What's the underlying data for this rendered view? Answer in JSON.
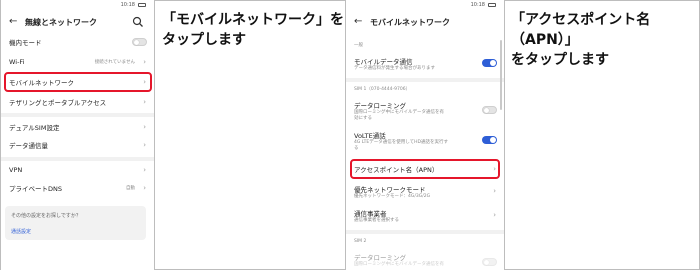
{
  "status": {
    "time1": "10:18",
    "time2": "10:18"
  },
  "left_screen": {
    "title": "無線とネットワーク",
    "items": [
      {
        "label": "機内モード"
      },
      {
        "label": "Wi-Fi",
        "value": "接続されていません"
      },
      {
        "label": "モバイルネットワーク"
      },
      {
        "label": "テザリングとポータブルアクセス"
      },
      {
        "label": "デュアルSIM設定"
      },
      {
        "label": "データ通信量"
      },
      {
        "label": "VPN"
      },
      {
        "label": "プライベートDNS",
        "value": "自動"
      }
    ],
    "help_card": {
      "question": "その他の設定をお探しですか？",
      "link": "通話設定"
    }
  },
  "instruction1": {
    "line1": "「モバイルネットワーク」を",
    "line2": "タップします"
  },
  "right_screen": {
    "title": "モバイルネットワーク",
    "section_general": "一般",
    "mobile_data": {
      "label": "モバイルデータ通信",
      "sub": "データ通信料が発生する場合があります"
    },
    "section_sim1": "SIM 1（070-4444-9706）",
    "roaming": {
      "label": "データローミング",
      "sub1": "国際ローミング中にモバイルデータ通信を有",
      "sub2": "効にする"
    },
    "volte": {
      "label": "VoLTE通話",
      "sub1": "4G LTEデータ通信を使用してHD通話を実行す",
      "sub2": "る"
    },
    "apn": {
      "label": "アクセスポイント名（APN）"
    },
    "pref_network": {
      "label": "優先ネットワークモード",
      "sub": "優先ネットワークモード：4G/3G/2G"
    },
    "carrier": {
      "label": "通信事業者",
      "sub": "通信事業者を選択する"
    },
    "section_sim2": "SIM 2",
    "roaming2": {
      "label": "データローミング",
      "sub": "国際ローミング中にモバイルデータ通信を有"
    }
  },
  "instruction2": {
    "line1": "「アクセスポイント名（APN）」",
    "line2": "をタップします"
  },
  "colors": {
    "highlight": "#e5162b",
    "accent": "#2e5ed6"
  }
}
